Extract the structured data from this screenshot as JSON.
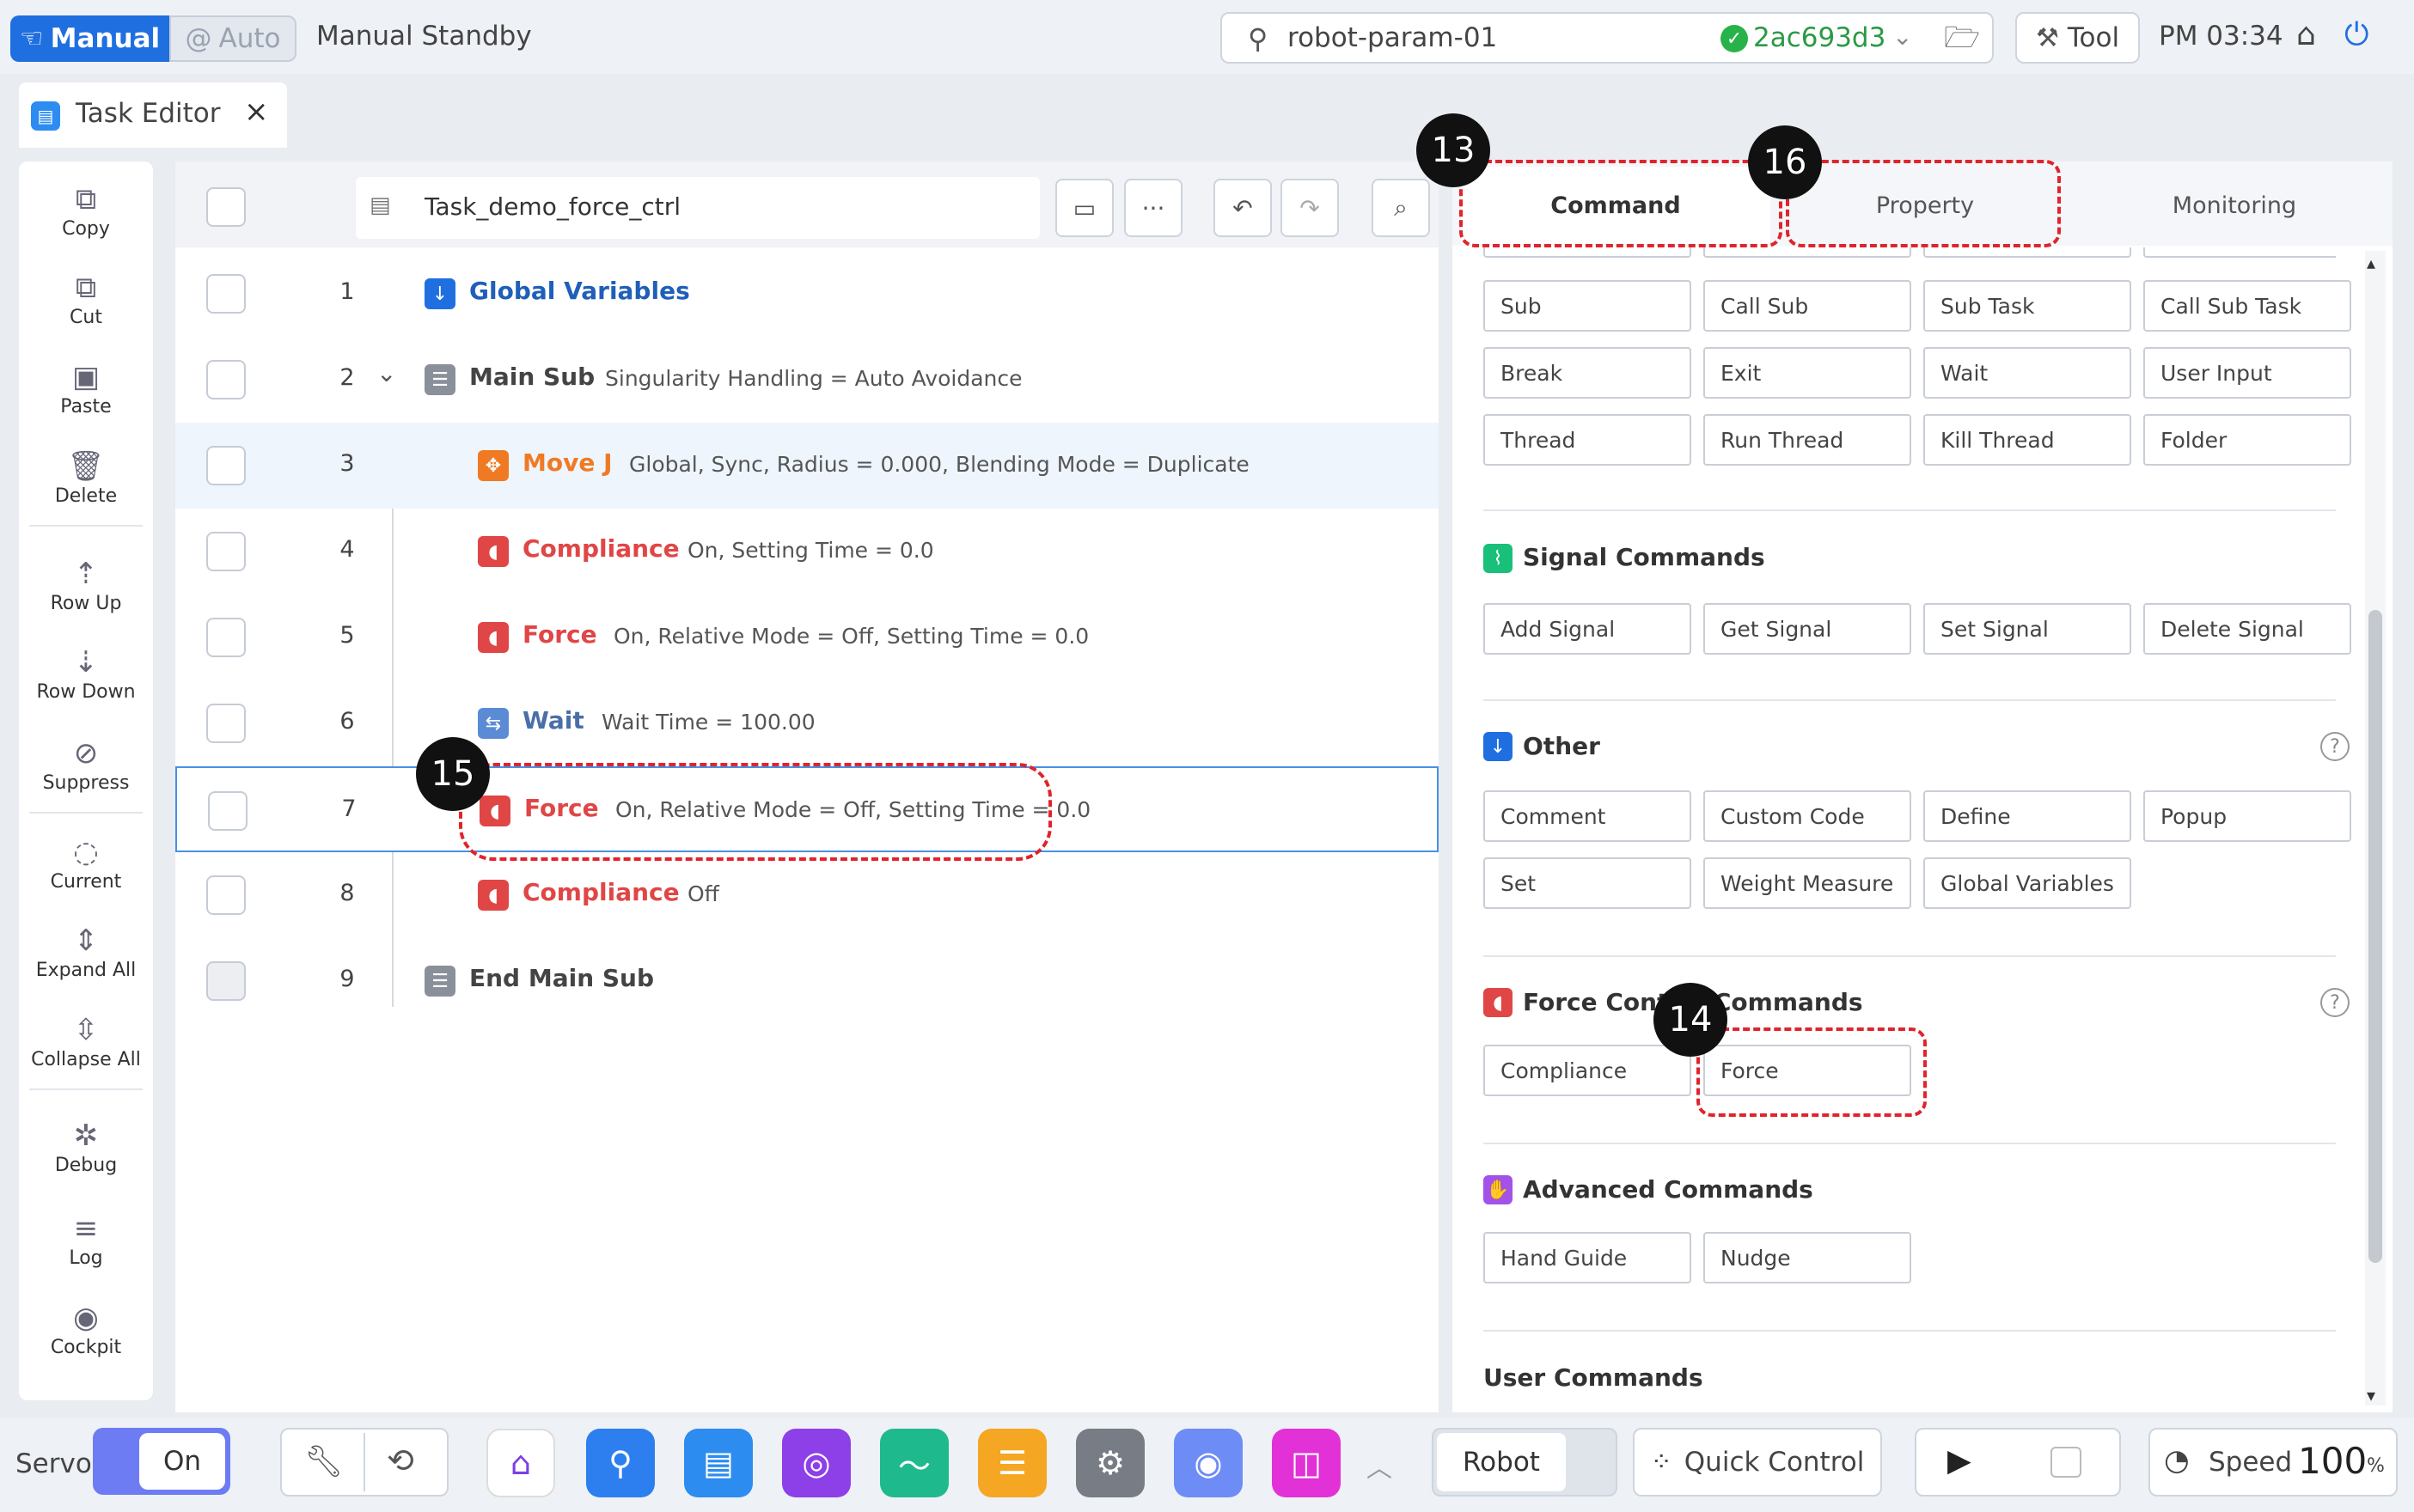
{
  "top_bar": {
    "mode_manual": "Manual",
    "mode_auto": "Auto",
    "status": "Manual Standby",
    "robot_param": "robot-param-01",
    "commit": "2ac693d3",
    "tool_label": "Tool",
    "time": "PM 03:34"
  },
  "tab": {
    "title": "Task Editor"
  },
  "left_toolbar": [
    {
      "label": "Copy",
      "icon": "copy-icon"
    },
    {
      "label": "Cut",
      "icon": "cut-icon"
    },
    {
      "label": "Paste",
      "icon": "paste-icon"
    },
    {
      "label": "Delete",
      "icon": "trash-icon"
    },
    {
      "label": "Row Up",
      "icon": "row-up-icon"
    },
    {
      "label": "Row Down",
      "icon": "row-down-icon"
    },
    {
      "label": "Suppress",
      "icon": "suppress-icon"
    },
    {
      "label": "Current",
      "icon": "current-icon"
    },
    {
      "label": "Expand All",
      "icon": "expand-icon"
    },
    {
      "label": "Collapse All",
      "icon": "collapse-icon"
    },
    {
      "label": "Debug",
      "icon": "debug-icon"
    },
    {
      "label": "Log",
      "icon": "log-icon"
    },
    {
      "label": "Cockpit",
      "icon": "cockpit-icon"
    }
  ],
  "editor": {
    "file_name": "Task_demo_force_ctrl",
    "rows": [
      {
        "num": "1",
        "name": "Global Variables",
        "desc": ""
      },
      {
        "num": "2",
        "name": "Main Sub",
        "desc": "Singularity Handling = Auto Avoidance"
      },
      {
        "num": "3",
        "name": "Move J",
        "desc": "Global, Sync, Radius = 0.000, Blending Mode = Duplicate"
      },
      {
        "num": "4",
        "name": "Compliance",
        "desc": "On, Setting Time = 0.0"
      },
      {
        "num": "5",
        "name": "Force",
        "desc": "On, Relative Mode = Off, Setting Time = 0.0"
      },
      {
        "num": "6",
        "name": "Wait",
        "desc": "Wait Time = 100.00"
      },
      {
        "num": "7",
        "name": "Force",
        "desc": "On, Relative Mode = Off, Setting Time = 0.0"
      },
      {
        "num": "8",
        "name": "Compliance",
        "desc": "Off"
      },
      {
        "num": "9",
        "name": "End Main Sub",
        "desc": ""
      }
    ]
  },
  "right_tabs": [
    "Command",
    "Property",
    "Monitoring"
  ],
  "flow_commands": [
    "Sub",
    "Call Sub",
    "Sub Task",
    "Call Sub Task",
    "Break",
    "Exit",
    "Wait",
    "User Input",
    "Thread",
    "Run Thread",
    "Kill Thread",
    "Folder"
  ],
  "sections": {
    "signal": {
      "title": "Signal Commands",
      "items": [
        "Add Signal",
        "Get Signal",
        "Set Signal",
        "Delete Signal"
      ]
    },
    "other": {
      "title": "Other",
      "items": [
        "Comment",
        "Custom Code",
        "Define",
        "Popup",
        "Set",
        "Weight Measure",
        "Global Variables"
      ]
    },
    "force": {
      "title": "Force Control Commands",
      "items": [
        "Compliance",
        "Force"
      ]
    },
    "advanced": {
      "title": "Advanced Commands",
      "items": [
        "Hand Guide",
        "Nudge"
      ]
    },
    "user": {
      "title": "User Commands"
    }
  },
  "markers": [
    "13",
    "14",
    "15",
    "16"
  ],
  "bottom_bar": {
    "servo_label": "Servo",
    "servo_state": "On",
    "robot_label": "Robot",
    "quick_control": "Quick Control",
    "speed_label": "Speed",
    "speed_value": "100",
    "speed_unit": "%"
  },
  "colors": {
    "accent": "#1f6fe0",
    "red": "#e04646",
    "orange": "#f07a24",
    "highlight": "#e0242c"
  }
}
